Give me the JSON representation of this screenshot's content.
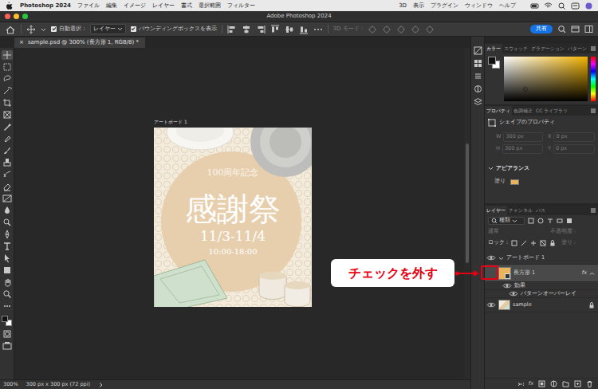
{
  "menubar": {
    "app": "Photoshop 2024",
    "menus": [
      "ファイル",
      "編集",
      "イメージ",
      "レイヤー",
      "書式",
      "選択範囲",
      "フィルター"
    ],
    "menus_right": [
      "3D",
      "表示",
      "プラグイン",
      "ウィンドウ",
      "ヘルプ"
    ]
  },
  "window": {
    "title": "Adobe Photoshop 2024"
  },
  "options_bar": {
    "auto_select": {
      "label": "自動選択 :",
      "checked": true
    },
    "target": "レイヤー",
    "bounding_box": {
      "label": "バウンディングボックスを表示",
      "checked": true
    },
    "mode_3d": "3D モード :",
    "share": "共有"
  },
  "document": {
    "tab": "sample.psd @ 300% (長方形 1, RGB/8) *",
    "close": "×"
  },
  "artboard": {
    "label": "アートボード 1",
    "texts": [
      "100周年記念",
      "感謝祭",
      "11/3-11/4",
      "10:00-18:00"
    ]
  },
  "callout": {
    "text": "チェックを外す"
  },
  "status_bar": {
    "zoom": "300%",
    "doc_size": "300 px x 300 px (72 ppi)"
  },
  "color_panel": {
    "tabs": [
      {
        "label": "カラー",
        "selected": true
      },
      {
        "label": "スウォッチ",
        "selected": false
      },
      {
        "label": "グラデーション",
        "selected": false
      },
      {
        "label": "パターン",
        "selected": false
      }
    ]
  },
  "properties_panel": {
    "tabs": [
      {
        "label": "プロパティ",
        "selected": true
      },
      {
        "label": "色調補正",
        "selected": false
      },
      {
        "label": "CC ライブラリ",
        "selected": false
      }
    ],
    "heading": "シェイプのプロパティ",
    "fields": [
      {
        "label": "W",
        "value": "300 px",
        "disabled": true
      },
      {
        "label": "X",
        "value": "0 px",
        "disabled": true
      },
      {
        "label": "H",
        "value": "300 px",
        "disabled": true
      },
      {
        "label": "Y",
        "value": "0 px",
        "disabled": true
      }
    ],
    "section": "アピアランス",
    "fill_label": "塗り"
  },
  "layers_panel": {
    "tabs": [
      {
        "label": "レイヤー",
        "selected": true
      },
      {
        "label": "チャンネル",
        "selected": false
      },
      {
        "label": "パス",
        "selected": false
      }
    ],
    "filter": "種類",
    "blend_mode": {
      "value": "通常",
      "disabled": true
    },
    "opacity_label": "不透明度 :",
    "lock_label": "ロック :",
    "fill_label": "塗り :",
    "layers": [
      {
        "kind": "artboard",
        "name": "アートボード 1",
        "visible": true,
        "selected": false,
        "highlighted": false,
        "expanded": true
      },
      {
        "kind": "shape",
        "name": "長方形 1",
        "visible": false,
        "selected": true,
        "highlighted": true,
        "expanded": true,
        "fx": "fx"
      },
      {
        "kind": "effects",
        "name": "効果",
        "visible": true,
        "selected": false,
        "highlighted": false
      },
      {
        "kind": "effect",
        "name": "パターンオーバーレイ",
        "visible": true,
        "selected": false,
        "highlighted": false
      },
      {
        "kind": "image",
        "name": "sample",
        "visible": true,
        "selected": false,
        "highlighted": false,
        "locked": true
      }
    ],
    "footer_fx": "fx"
  }
}
